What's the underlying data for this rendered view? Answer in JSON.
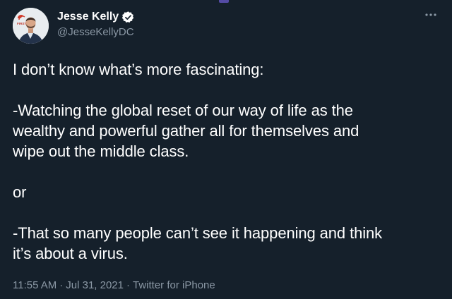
{
  "tweet": {
    "author": {
      "display_name": "Jesse Kelly",
      "handle": "@JesseKellyDC",
      "avatar_badge_text": "FIRST",
      "verified": true
    },
    "text_paragraphs": [
      "I don’t know what’s more fascinating:",
      "-Watching the global reset of our way of life as the\nwealthy and powerful gather all for themselves and\nwipe out the middle class.",
      "or",
      "-That so many people can’t see it happening and think\nit’s about a virus."
    ],
    "meta": {
      "time": "11:55 AM",
      "separator": "·",
      "date": "Jul 31, 2021",
      "source": "Twitter for iPhone"
    }
  },
  "icons": {
    "verified": "verified-badge-icon",
    "more": "more-options-icon"
  },
  "colors": {
    "background": "#15202b",
    "primary_text": "#ffffff",
    "secondary_text": "#8b98a5",
    "verified_badge": "#ffffff"
  }
}
